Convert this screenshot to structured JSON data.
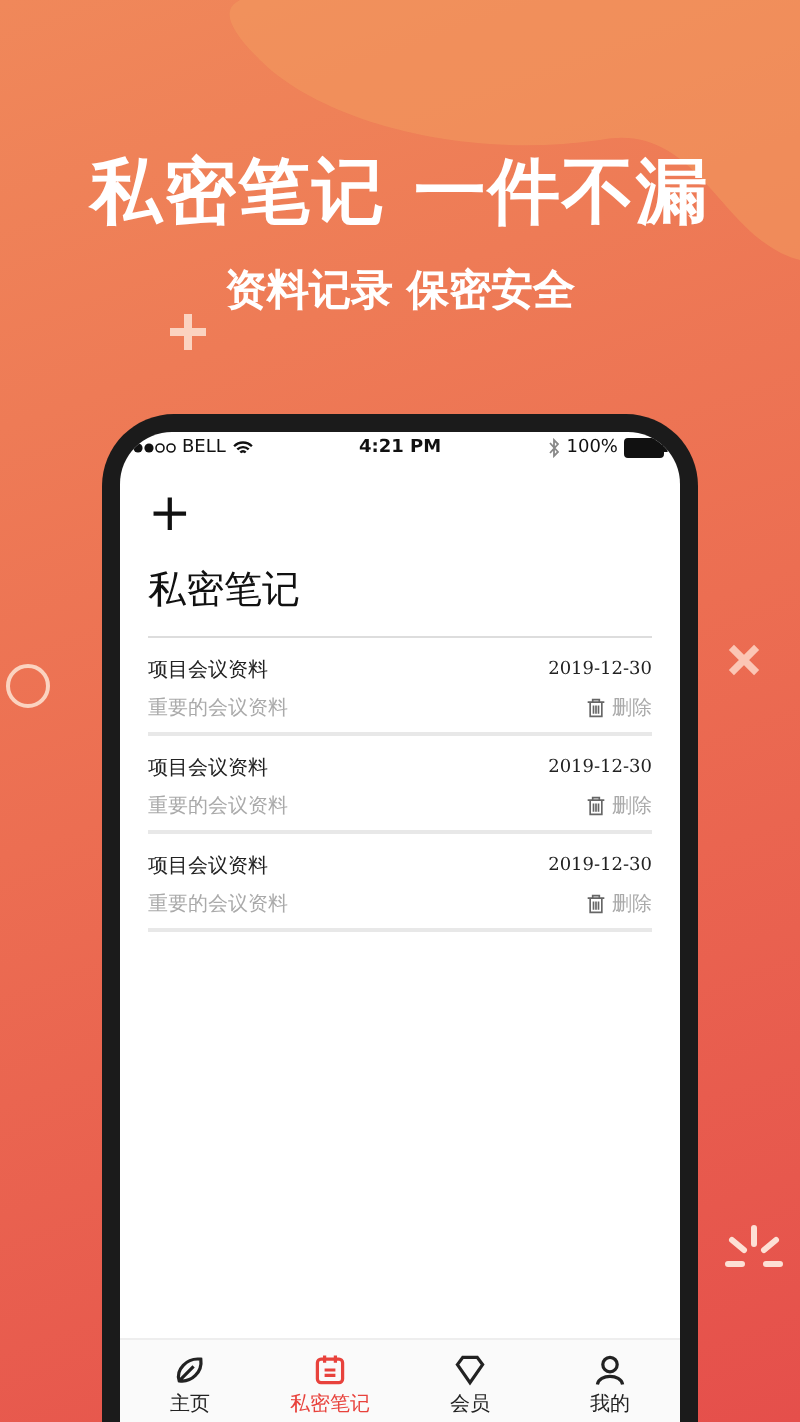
{
  "headline": "私密笔记 一件不漏",
  "subtitle": "资料记录 保密安全",
  "status_bar": {
    "carrier": "BELL",
    "time": "4:21 PM",
    "battery": "100%"
  },
  "add_button": "+",
  "title": "私密笔记",
  "notes": [
    {
      "title": "项目会议资料",
      "date": "2019-12-30",
      "summary": "重要的会议资料",
      "delete": "删除"
    },
    {
      "title": "项目会议资料",
      "date": "2019-12-30",
      "summary": "重要的会议资料",
      "delete": "删除"
    },
    {
      "title": "项目会议资料",
      "date": "2019-12-30",
      "summary": "重要的会议资料",
      "delete": "删除"
    }
  ],
  "tabs": [
    {
      "label": "主页",
      "kind": "home",
      "selected": false
    },
    {
      "label": "私密笔记",
      "kind": "notes",
      "selected": true
    },
    {
      "label": "会员",
      "kind": "member",
      "selected": false
    },
    {
      "label": "我的",
      "kind": "me",
      "selected": false
    }
  ]
}
